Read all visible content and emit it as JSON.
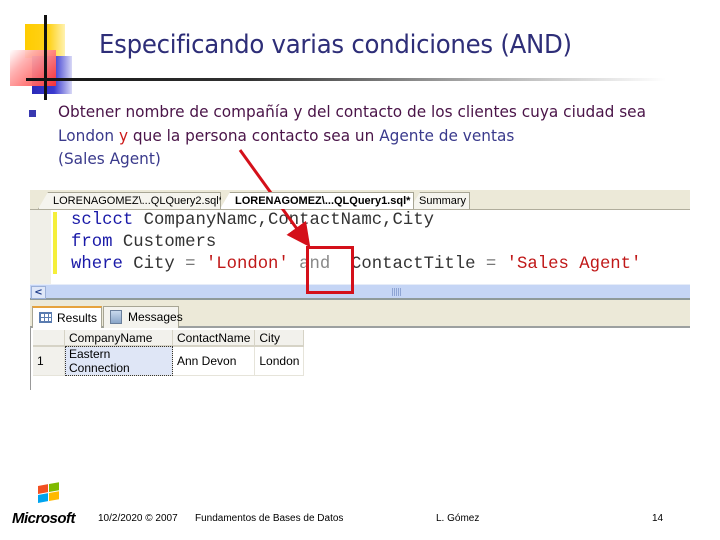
{
  "slide": {
    "title": "Especificando varias condiciones (AND)",
    "bullet": {
      "part1": "Obtener nombre de compañía y del contacto de los clientes cuya ciudad sea ",
      "london": "London",
      "space1": " ",
      "y": "y",
      "part2": " que la persona contacto sea un ",
      "agente": "Agente de ventas",
      "space2": " ",
      "sales_agent": "(Sales Agent)"
    }
  },
  "editor": {
    "tabs": [
      {
        "label": "LORENAGOMEZ\\...QLQuery2.sql*",
        "active": false
      },
      {
        "label": "LORENAGOMEZ\\...QLQuery1.sql*",
        "active": true
      },
      {
        "label": "Summary",
        "active": false
      }
    ],
    "code": {
      "line1_kw": "sclcct",
      "line1_rest": " CompanyNamc,ContactNamc,City",
      "line2_kw": "from",
      "line2_rest": " Customers",
      "line3_kw": "where",
      "line3_col": " City ",
      "line3_eq": "=",
      "line3_str1": " 'London'",
      "line3_and": " and",
      "line3_col2": "  ContactTitle ",
      "line3_eq2": "=",
      "line3_str2": " 'Sales Agent'"
    },
    "scroll_left_glyph": "<"
  },
  "results": {
    "tabs": [
      {
        "label": "Results",
        "icon": "grid-icon",
        "active": true
      },
      {
        "label": "Messages",
        "icon": "messages-icon",
        "active": false
      }
    ],
    "columns": [
      "CompanyName",
      "ContactName",
      "City"
    ],
    "rows": [
      {
        "num": "1",
        "CompanyName": "Eastern Connection",
        "ContactName": "Ann Devon",
        "City": "London"
      }
    ]
  },
  "annotation": {
    "highlight_color": "#d4101a",
    "target": "and"
  },
  "footer": {
    "logo": "Microsoft",
    "date": "10/2/2020 © 2007",
    "course": "Fundamentos de Bases de Datos",
    "author": "L. Gómez",
    "page": "14"
  }
}
